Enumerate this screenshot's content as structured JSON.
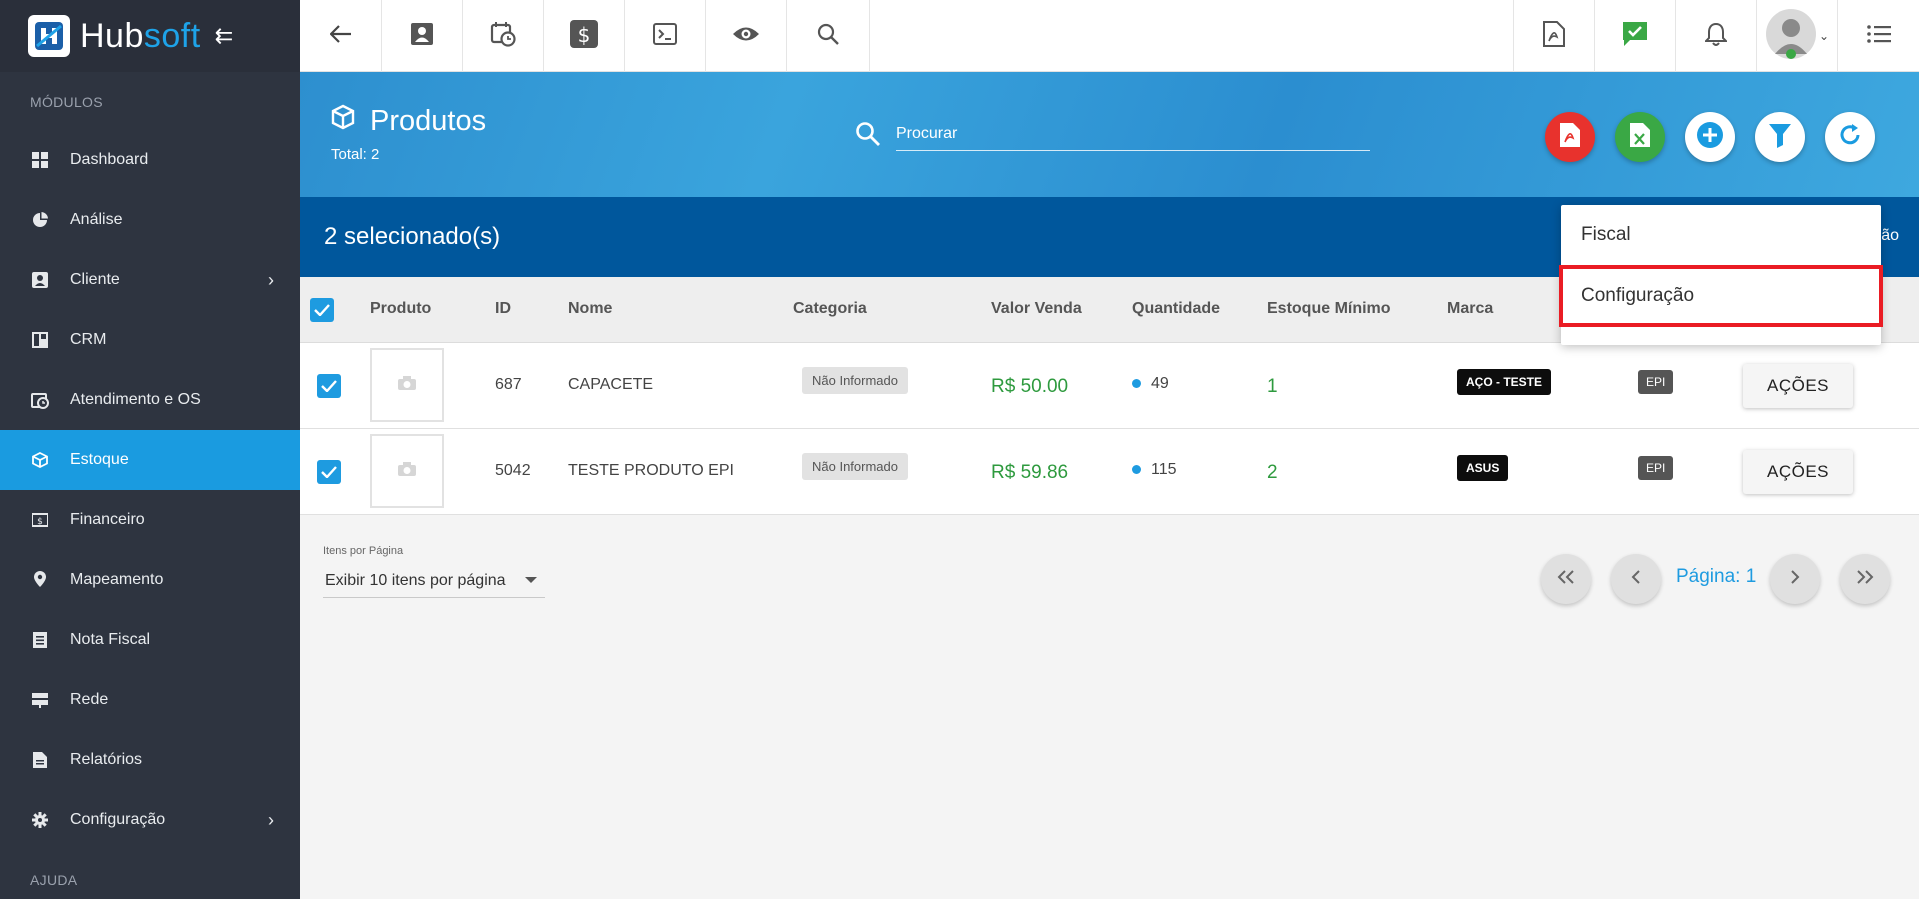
{
  "brand": {
    "name_part1": "Hub",
    "name_part2": "soft"
  },
  "sidebar": {
    "section_modules": "MÓDULOS",
    "section_help": "AJUDA",
    "items": [
      {
        "label": "Dashboard",
        "icon": "dashboard-icon"
      },
      {
        "label": "Análise",
        "icon": "pie-chart-icon"
      },
      {
        "label": "Cliente",
        "icon": "contact-card-icon",
        "has_submenu": true
      },
      {
        "label": "CRM",
        "icon": "board-icon"
      },
      {
        "label": "Atendimento e OS",
        "icon": "calendar-clock-icon"
      },
      {
        "label": "Estoque",
        "icon": "box-icon",
        "active": true
      },
      {
        "label": "Financeiro",
        "icon": "money-icon"
      },
      {
        "label": "Mapeamento",
        "icon": "map-pin-icon"
      },
      {
        "label": "Nota Fiscal",
        "icon": "receipt-icon"
      },
      {
        "label": "Rede",
        "icon": "server-icon"
      },
      {
        "label": "Relatórios",
        "icon": "document-icon"
      },
      {
        "label": "Configuração",
        "icon": "gear-icon",
        "has_submenu": true
      }
    ]
  },
  "topbar": {
    "left_icons": [
      "back-arrow-icon",
      "contact-card-icon",
      "calendar-clock-icon",
      "dollar-icon",
      "terminal-icon",
      "eye-icon",
      "search-icon"
    ],
    "right_icons": [
      "pdf-icon",
      "chat-check-icon",
      "bell-icon",
      "user-avatar",
      "list-menu-icon"
    ]
  },
  "header": {
    "title": "Produtos",
    "total": "Total: 2",
    "search_placeholder": "Procurar"
  },
  "selection": {
    "text": "2 selecionado(s)",
    "tail": "ão"
  },
  "table": {
    "columns": [
      "Produto",
      "ID",
      "Nome",
      "Categoria",
      "Valor Venda",
      "Quantidade",
      "Estoque Mínimo",
      "Marca"
    ],
    "rows": [
      {
        "id": "687",
        "name": "CAPACETE",
        "category": "Não Informado",
        "price": "R$ 50.00",
        "qty": "49",
        "min_stock": "1",
        "brand": "AÇO - TESTE",
        "tag": "EPI",
        "action": "AÇÕES"
      },
      {
        "id": "5042",
        "name": "TESTE PRODUTO EPI",
        "category": "Não Informado",
        "price": "R$ 59.86",
        "qty": "115",
        "min_stock": "2",
        "brand": "ASUS",
        "tag": "EPI",
        "action": "AÇÕES"
      }
    ]
  },
  "pagination": {
    "per_page_label": "Itens por Página",
    "per_page_value": "Exibir 10 itens por página",
    "page_label": "Página: 1"
  },
  "dropdown": {
    "items": [
      "Fiscal",
      "Configuração"
    ]
  },
  "colors": {
    "sidebar_bg": "#2e3440",
    "accent": "#1a9be0",
    "selection_bar": "#00579c",
    "price_green": "#2e9a3e",
    "highlight_red": "#ea1c24"
  }
}
